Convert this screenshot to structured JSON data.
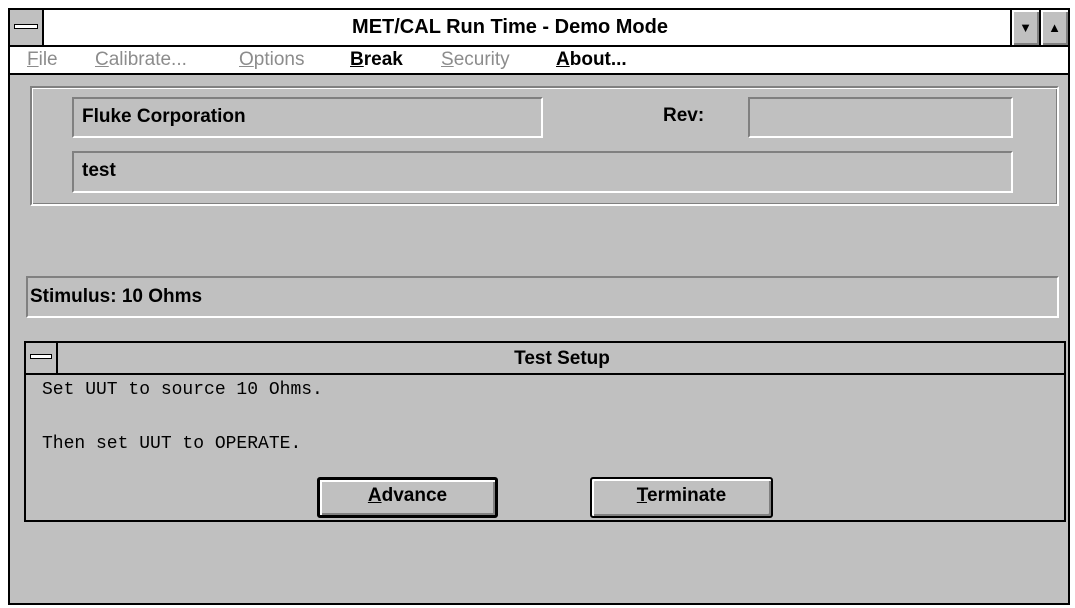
{
  "window": {
    "title": "MET/CAL Run Time - Demo Mode",
    "minimize_glyph": "▼",
    "maximize_glyph": "▲"
  },
  "menu": [
    {
      "label": "File",
      "mnemonic": "F",
      "rest": "ile",
      "enabled": false
    },
    {
      "label": "Calibrate...",
      "mnemonic": "C",
      "rest": "alibrate...",
      "enabled": false
    },
    {
      "label": "Options",
      "mnemonic": "O",
      "rest": "ptions",
      "enabled": false
    },
    {
      "label": "Break",
      "mnemonic": "B",
      "rest": "reak",
      "enabled": true
    },
    {
      "label": "Security",
      "mnemonic": "S",
      "rest": "ecurity",
      "enabled": false
    },
    {
      "label": "About...",
      "mnemonic": "A",
      "rest": "bout...",
      "enabled": true
    }
  ],
  "header": {
    "company": "Fluke Corporation",
    "rev_label": "Rev:",
    "rev_value": "",
    "procedure": "test"
  },
  "stimulus": {
    "text": "Stimulus:  10 Ohms"
  },
  "test_setup": {
    "title": "Test Setup",
    "line1": "Set UUT to source 10 Ohms.",
    "line2": "Then set UUT to OPERATE.",
    "advance_mnemonic": "A",
    "advance_rest": "dvance",
    "terminate_mnemonic": "T",
    "terminate_rest": "erminate"
  }
}
